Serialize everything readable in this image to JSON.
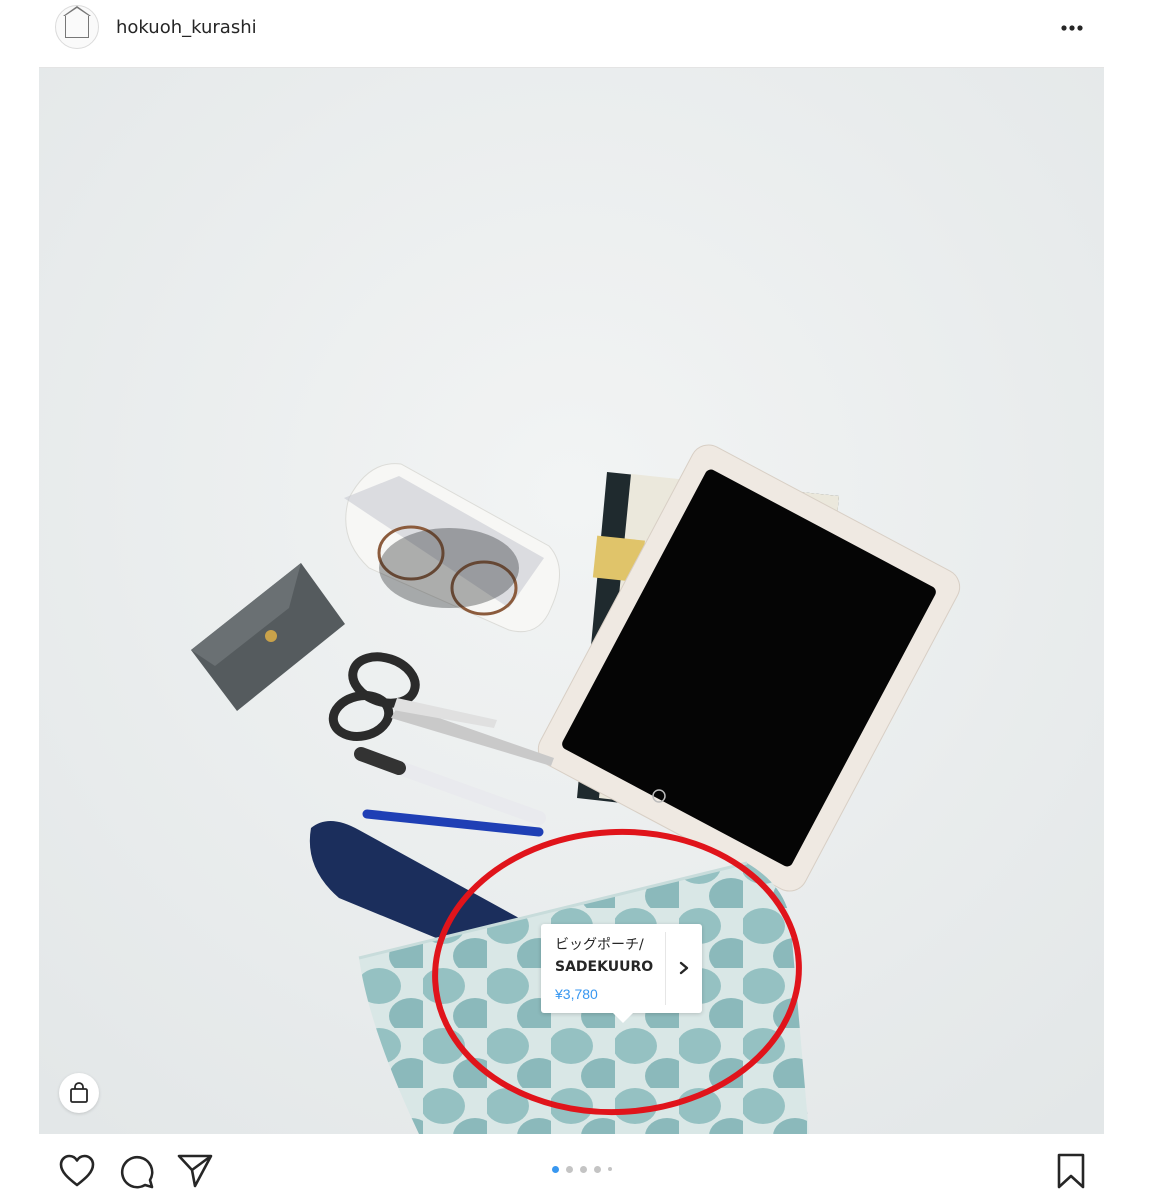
{
  "header": {
    "username": "hokuoh_kurashi",
    "avatar_icon": "house-logo-icon",
    "more_icon": "more-options-icon"
  },
  "product_tag": {
    "name_line1": "ビッグポーチ/",
    "name_line2": "SADEKUURO",
    "price": "¥3,780",
    "price_color": "#3897f0",
    "arrow_icon": "chevron-right-icon"
  },
  "annotation": {
    "color": "#e0141b",
    "shape": "ellipse"
  },
  "shopping_bag_icon": "shopping-bag-icon",
  "actions": {
    "like_icon": "heart-icon",
    "comment_icon": "comment-icon",
    "share_icon": "send-icon",
    "save_icon": "bookmark-icon"
  },
  "carousel": {
    "count": 5,
    "active_index": 0,
    "active_color": "#3897f0"
  }
}
